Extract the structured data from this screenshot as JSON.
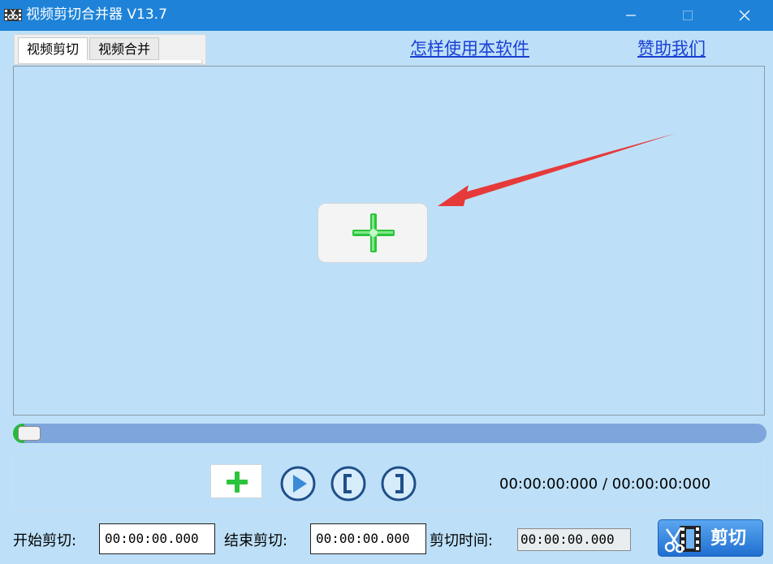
{
  "window": {
    "title": "视频剪切合并器 V13.7",
    "icon": "film-scissors-icon"
  },
  "tabs": [
    {
      "label": "视频剪切",
      "selected": true
    },
    {
      "label": "视频合并",
      "selected": false
    }
  ],
  "links": {
    "how_to_use": "怎样使用本软件",
    "sponsor": "赞助我们"
  },
  "preview": {
    "add_icon": "green-plus-icon"
  },
  "slider": {
    "progress": 0
  },
  "controls": {
    "add_icon": "green-plus-icon",
    "play_icon": "play-icon",
    "mark_in_icon": "bracket-left-icon",
    "mark_out_icon": "bracket-right-icon",
    "timecode": "00:00:00:000 / 00:00:00:000"
  },
  "bottom": {
    "start_label": "开始剪切:",
    "start_value": "00:00:00.000",
    "end_label": "结束剪切:",
    "end_value": "00:00:00.000",
    "duration_label": "剪切时间:",
    "duration_value": "00:00:00.000",
    "cut_button": "剪切"
  },
  "colors": {
    "titlebar": "#1e83d8",
    "background": "#bde0f8",
    "link": "#1a3fd6",
    "accent_green": "#29b93a",
    "arrow": "#e63a3a"
  }
}
